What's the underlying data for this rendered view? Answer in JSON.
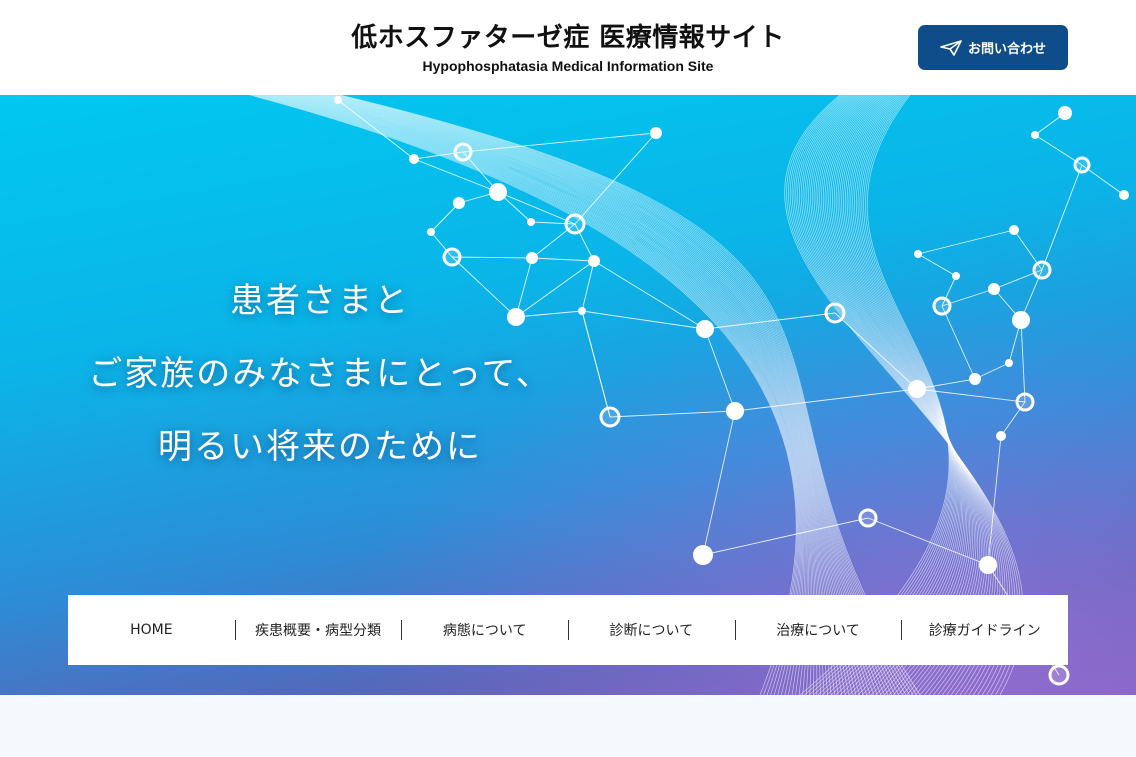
{
  "header": {
    "title": "低ホスファターゼ症 医療情報サイト",
    "subtitle": "Hypophosphatasia Medical Information Site",
    "contact_button": {
      "label": "お問い合わせ",
      "icon": "paper-plane-icon"
    }
  },
  "hero": {
    "lines": [
      "患者さまと",
      "ご家族のみなさまにとって、",
      "明るい将来のために"
    ]
  },
  "nav": {
    "items": [
      {
        "label": "HOME"
      },
      {
        "label": "疾患概要・病型分類"
      },
      {
        "label": "病態について"
      },
      {
        "label": "診断について"
      },
      {
        "label": "治療について"
      },
      {
        "label": "診療ガイドライン"
      }
    ]
  },
  "colors": {
    "brand": "#0f4d8a",
    "hero_top": "#00c8f0",
    "hero_bottom": "#7a5fb8"
  }
}
